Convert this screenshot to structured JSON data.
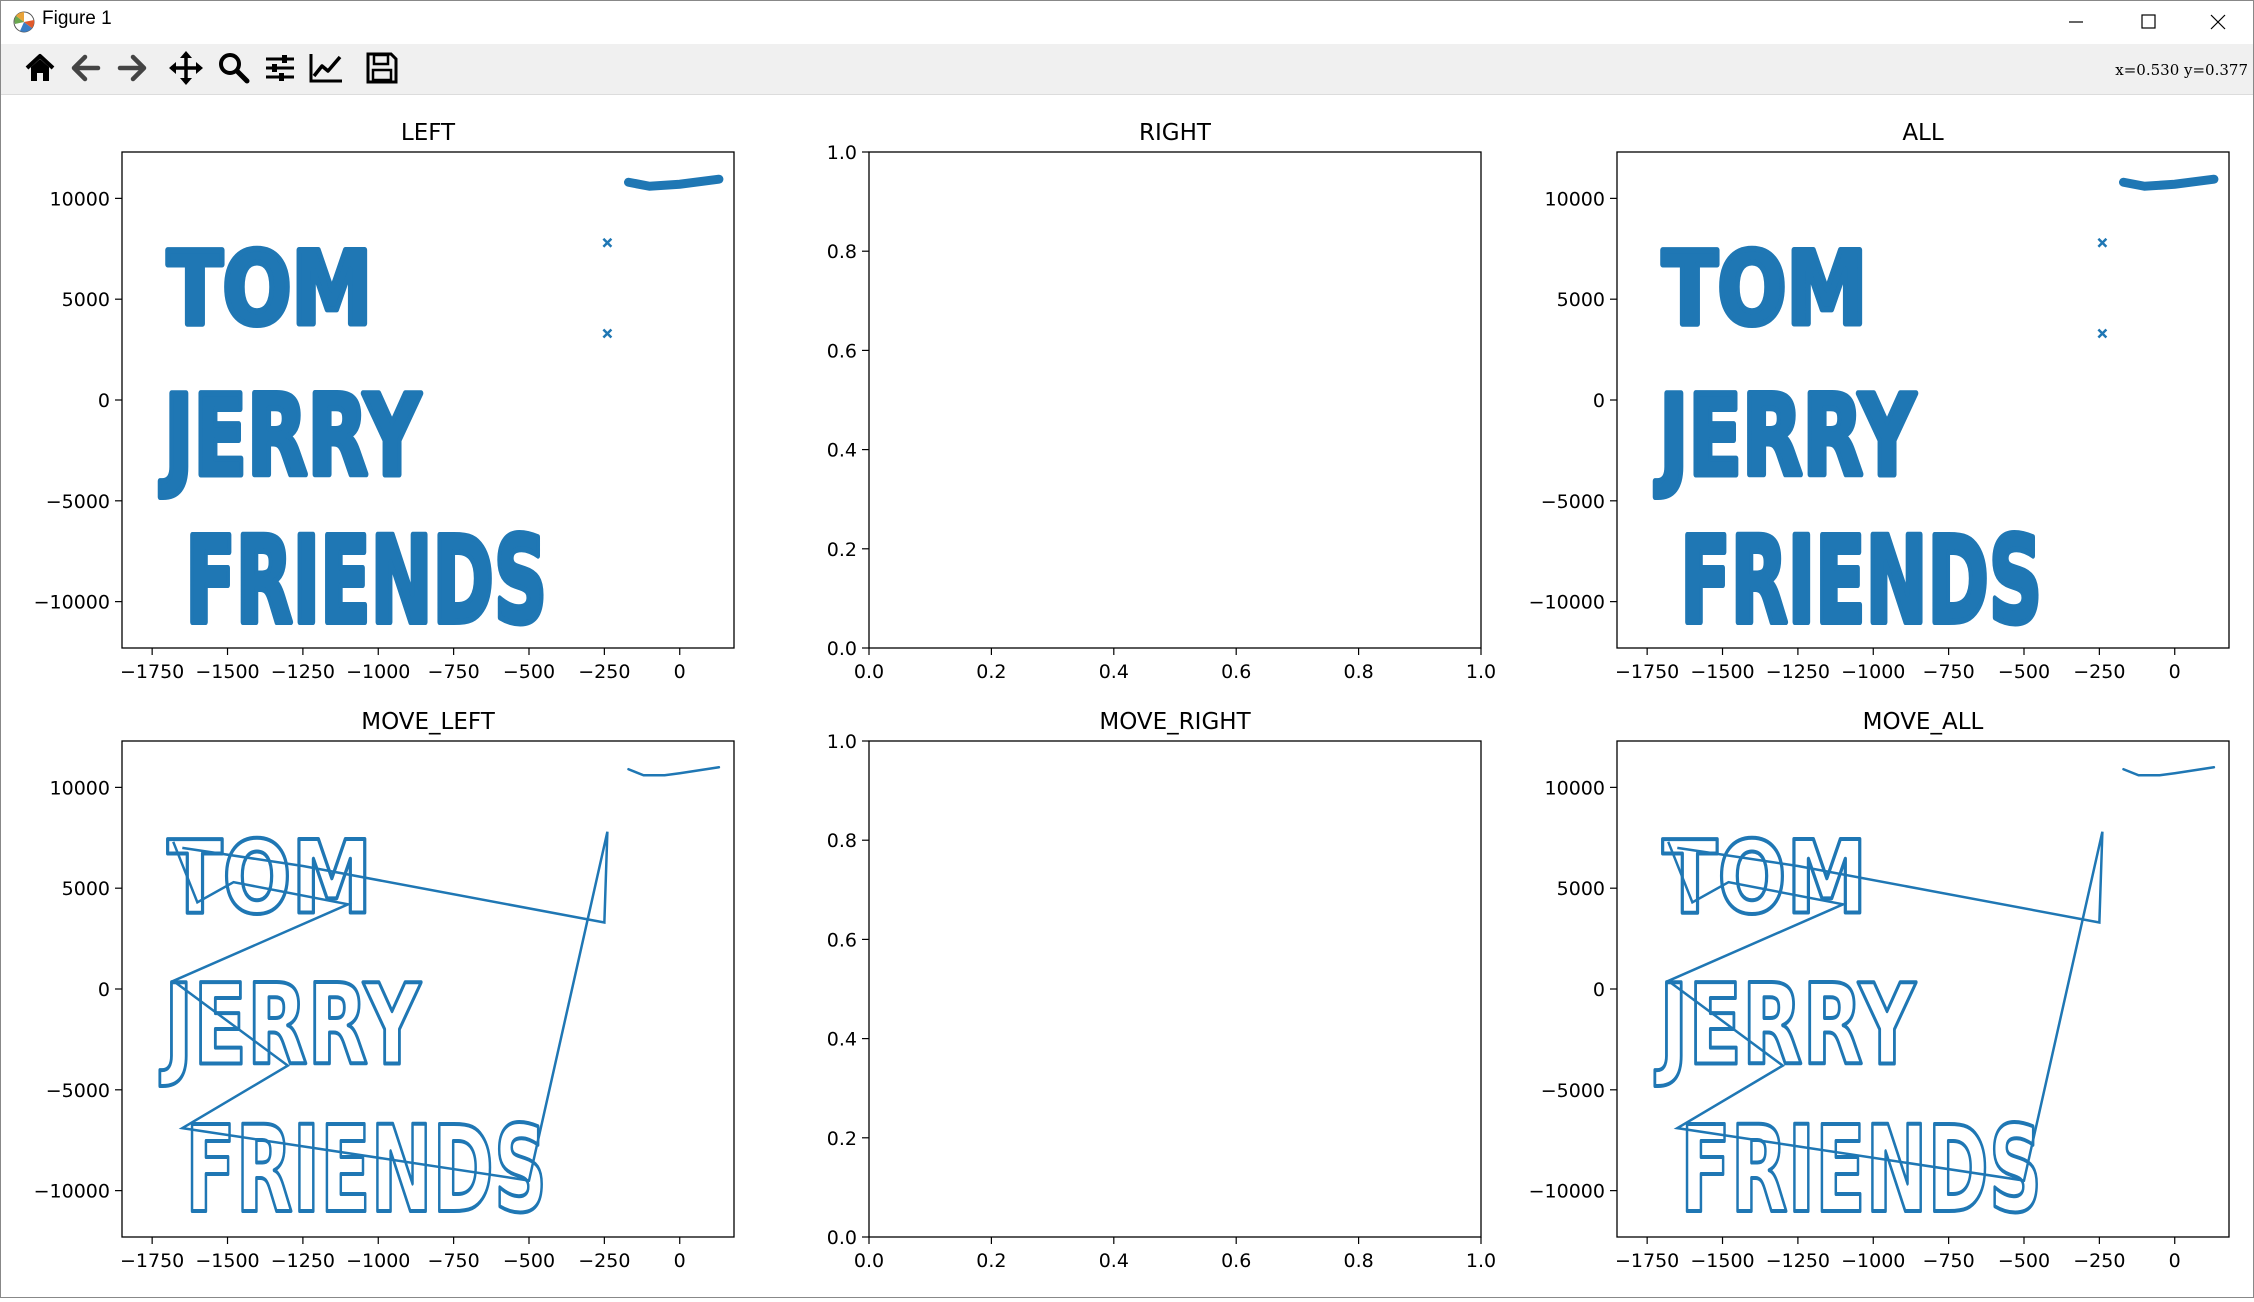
{
  "window": {
    "title": "Figure 1",
    "controls": [
      "minimize",
      "maximize",
      "close"
    ]
  },
  "toolbar": {
    "buttons": [
      {
        "name": "home",
        "icon": "home-icon"
      },
      {
        "name": "back",
        "icon": "arrow-left-icon"
      },
      {
        "name": "forward",
        "icon": "arrow-right-icon"
      },
      {
        "name": "pan",
        "icon": "move-icon"
      },
      {
        "name": "zoom",
        "icon": "magnifier-icon"
      },
      {
        "name": "configure-subplots",
        "icon": "sliders-icon"
      },
      {
        "name": "edit-axis",
        "icon": "line-chart-icon"
      },
      {
        "name": "save",
        "icon": "floppy-disk-icon"
      }
    ],
    "coords": "x=0.530  y=0.377"
  },
  "colors": {
    "series": "#1f77b4",
    "toolbar_bg": "#f0f0f0",
    "axes_edge": "#000000"
  },
  "chart_data": [
    {
      "type": "scatter",
      "title": "LEFT",
      "marker": "x",
      "xlim": [
        -1850,
        180
      ],
      "ylim": [
        -12300,
        12300
      ],
      "xticks": [
        -1750,
        -1500,
        -1250,
        -1000,
        -750,
        -500,
        -250,
        0
      ],
      "xtick_labels": [
        "−1750",
        "−1500",
        "−1250",
        "−1000",
        "−750",
        "−500",
        "−250",
        "0"
      ],
      "yticks": [
        10000,
        5000,
        0,
        -5000,
        -10000
      ],
      "ytick_labels": [
        "10000",
        "5000",
        "0",
        "−5000",
        "−10000"
      ],
      "text_shapes": [
        {
          "text": "TOM",
          "x_start": -1700,
          "x_end": -1020,
          "y_low": 3800,
          "y_high": 7600
        },
        {
          "text": "JERRY",
          "x_start": -1710,
          "x_end": -860,
          "y_low": -3700,
          "y_high": 500
        },
        {
          "text": "FRIENDS",
          "x_start": -1640,
          "x_end": -440,
          "y_low": -11000,
          "y_high": -6500
        }
      ],
      "points": [
        [
          -240,
          7800
        ],
        [
          -240,
          3300
        ]
      ],
      "stroke": [
        [
          -170,
          10800
        ],
        [
          -100,
          10600
        ],
        [
          0,
          10700
        ],
        [
          130,
          10950
        ]
      ]
    },
    {
      "type": "scatter",
      "title": "RIGHT",
      "xlim": [
        0,
        1
      ],
      "ylim": [
        0,
        1
      ],
      "xticks": [
        0,
        0.2,
        0.4,
        0.6,
        0.8,
        1
      ],
      "xtick_labels": [
        "0.0",
        "0.2",
        "0.4",
        "0.6",
        "0.8",
        "1.0"
      ],
      "yticks": [
        0,
        0.2,
        0.4,
        0.6,
        0.8,
        1
      ],
      "ytick_labels": [
        "0.0",
        "0.2",
        "0.4",
        "0.6",
        "0.8",
        "1.0"
      ]
    },
    {
      "type": "scatter",
      "title": "ALL",
      "marker": "x",
      "xlim": [
        -1850,
        180
      ],
      "ylim": [
        -12300,
        12300
      ],
      "xticks": [
        -1750,
        -1500,
        -1250,
        -1000,
        -750,
        -500,
        -250,
        0
      ],
      "xtick_labels": [
        "−1750",
        "−1500",
        "−1250",
        "−1000",
        "−750",
        "−500",
        "−250",
        "0"
      ],
      "yticks": [
        10000,
        5000,
        0,
        -5000,
        -10000
      ],
      "ytick_labels": [
        "10000",
        "5000",
        "0",
        "−5000",
        "−10000"
      ],
      "text_shapes": [
        {
          "text": "TOM",
          "x_start": -1700,
          "x_end": -1020,
          "y_low": 3800,
          "y_high": 7600
        },
        {
          "text": "JERRY",
          "x_start": -1710,
          "x_end": -860,
          "y_low": -3700,
          "y_high": 500
        },
        {
          "text": "FRIENDS",
          "x_start": -1640,
          "x_end": -440,
          "y_low": -11000,
          "y_high": -6500
        }
      ],
      "points": [
        [
          -240,
          7800
        ],
        [
          -240,
          3300
        ]
      ],
      "stroke": [
        [
          -170,
          10800
        ],
        [
          -100,
          10600
        ],
        [
          0,
          10700
        ],
        [
          130,
          10950
        ]
      ]
    },
    {
      "type": "line",
      "title": "MOVE_LEFT",
      "xlim": [
        -1850,
        180
      ],
      "ylim": [
        -12300,
        12300
      ],
      "xticks": [
        -1750,
        -1500,
        -1250,
        -1000,
        -750,
        -500,
        -250,
        0
      ],
      "xtick_labels": [
        "−1750",
        "−1500",
        "−1250",
        "−1000",
        "−750",
        "−500",
        "−250",
        "0"
      ],
      "yticks": [
        10000,
        5000,
        0,
        -5000,
        -10000
      ],
      "ytick_labels": [
        "10000",
        "5000",
        "0",
        "−5000",
        "−10000"
      ],
      "text_shapes": [
        {
          "text": "TOM",
          "x_start": -1700,
          "x_end": -1020,
          "y_low": 3800,
          "y_high": 7600
        },
        {
          "text": "JERRY",
          "x_start": -1710,
          "x_end": -860,
          "y_low": -3700,
          "y_high": 500
        },
        {
          "text": "FRIENDS",
          "x_start": -1640,
          "x_end": -440,
          "y_low": -11000,
          "y_high": -6500
        }
      ],
      "path": [
        [
          -1650,
          7000
        ],
        [
          -1250,
          6100
        ],
        [
          -250,
          3300
        ],
        [
          -240,
          7800
        ],
        [
          -500,
          -9500
        ],
        [
          -1650,
          -6900
        ],
        [
          -1300,
          -3800
        ],
        [
          -1680,
          400
        ],
        [
          -1100,
          4200
        ],
        [
          -1480,
          5300
        ],
        [
          -1600,
          4300
        ],
        [
          -1680,
          7300
        ]
      ],
      "stroke": [
        [
          -170,
          10900
        ],
        [
          -120,
          10600
        ],
        [
          -50,
          10600
        ],
        [
          0,
          10700
        ],
        [
          130,
          11000
        ]
      ]
    },
    {
      "type": "line",
      "title": "MOVE_RIGHT",
      "xlim": [
        0,
        1
      ],
      "ylim": [
        0,
        1
      ],
      "xticks": [
        0,
        0.2,
        0.4,
        0.6,
        0.8,
        1
      ],
      "xtick_labels": [
        "0.0",
        "0.2",
        "0.4",
        "0.6",
        "0.8",
        "1.0"
      ],
      "yticks": [
        0,
        0.2,
        0.4,
        0.6,
        0.8,
        1
      ],
      "ytick_labels": [
        "0.0",
        "0.2",
        "0.4",
        "0.6",
        "0.8",
        "1.0"
      ]
    },
    {
      "type": "line",
      "title": "MOVE_ALL",
      "xlim": [
        -1850,
        180
      ],
      "ylim": [
        -12300,
        12300
      ],
      "xticks": [
        -1750,
        -1500,
        -1250,
        -1000,
        -750,
        -500,
        -250,
        0
      ],
      "xtick_labels": [
        "−1750",
        "−1500",
        "−1250",
        "−1000",
        "−750",
        "−500",
        "−250",
        "0"
      ],
      "yticks": [
        10000,
        5000,
        0,
        -5000,
        -10000
      ],
      "ytick_labels": [
        "10000",
        "5000",
        "0",
        "−5000",
        "−10000"
      ],
      "text_shapes": [
        {
          "text": "TOM",
          "x_start": -1700,
          "x_end": -1020,
          "y_low": 3800,
          "y_high": 7600
        },
        {
          "text": "JERRY",
          "x_start": -1710,
          "x_end": -860,
          "y_low": -3700,
          "y_high": 500
        },
        {
          "text": "FRIENDS",
          "x_start": -1640,
          "x_end": -440,
          "y_low": -11000,
          "y_high": -6500
        }
      ],
      "path": [
        [
          -1650,
          7000
        ],
        [
          -1250,
          6100
        ],
        [
          -250,
          3300
        ],
        [
          -240,
          7800
        ],
        [
          -500,
          -9500
        ],
        [
          -1650,
          -6900
        ],
        [
          -1300,
          -3800
        ],
        [
          -1680,
          400
        ],
        [
          -1100,
          4200
        ],
        [
          -1480,
          5300
        ],
        [
          -1600,
          4300
        ],
        [
          -1680,
          7300
        ]
      ],
      "stroke": [
        [
          -170,
          10900
        ],
        [
          -120,
          10600
        ],
        [
          -50,
          10600
        ],
        [
          0,
          10700
        ],
        [
          130,
          11000
        ]
      ]
    }
  ]
}
